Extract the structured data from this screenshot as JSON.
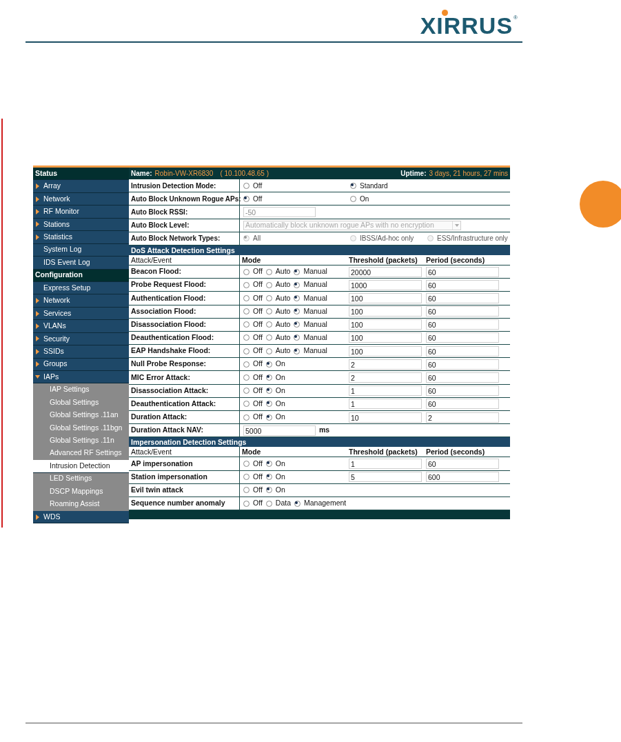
{
  "logo": {
    "text": "XIRRUS",
    "mark": "®"
  },
  "sidebar": [
    {
      "label": "Status",
      "kind": "section"
    },
    {
      "label": "Array",
      "kind": "item",
      "expanded": false,
      "selected": false
    },
    {
      "label": "Network",
      "kind": "item",
      "expanded": false,
      "selected": false
    },
    {
      "label": "RF Monitor",
      "kind": "item",
      "expanded": false,
      "selected": false
    },
    {
      "label": "Stations",
      "kind": "item",
      "expanded": false,
      "selected": false
    },
    {
      "label": "Statistics",
      "kind": "item",
      "expanded": false,
      "selected": false
    },
    {
      "label": "System Log",
      "kind": "item",
      "selected": false
    },
    {
      "label": "IDS Event Log",
      "kind": "item",
      "selected": false
    },
    {
      "label": "Configuration",
      "kind": "section"
    },
    {
      "label": "Express Setup",
      "kind": "item",
      "selected": false
    },
    {
      "label": "Network",
      "kind": "item",
      "expanded": false,
      "selected": false
    },
    {
      "label": "Services",
      "kind": "item",
      "expanded": false,
      "selected": false
    },
    {
      "label": "VLANs",
      "kind": "item",
      "expanded": false,
      "selected": false
    },
    {
      "label": "Security",
      "kind": "item",
      "expanded": false,
      "selected": false
    },
    {
      "label": "SSIDs",
      "kind": "item",
      "expanded": false,
      "selected": false
    },
    {
      "label": "Groups",
      "kind": "item",
      "expanded": false,
      "selected": false
    },
    {
      "label": "IAPs",
      "kind": "item",
      "expanded": true,
      "selected": false
    },
    {
      "label": "IAP Settings",
      "kind": "subitem",
      "selected": false
    },
    {
      "label": "Global Settings",
      "kind": "subitem",
      "selected": false
    },
    {
      "label": "Global Settings .11an",
      "kind": "subitem",
      "selected": false
    },
    {
      "label": "Global Settings .11bgn",
      "kind": "subitem",
      "selected": false
    },
    {
      "label": "Global Settings .11n",
      "kind": "subitem",
      "selected": false
    },
    {
      "label": "Advanced RF Settings",
      "kind": "subitem",
      "selected": false
    },
    {
      "label": "Intrusion Detection",
      "kind": "subitem",
      "selected": true
    },
    {
      "label": "LED Settings",
      "kind": "subitem",
      "selected": false
    },
    {
      "label": "DSCP Mappings",
      "kind": "subitem",
      "selected": false
    },
    {
      "label": "Roaming Assist",
      "kind": "subitem",
      "selected": false
    },
    {
      "label": "WDS",
      "kind": "item",
      "expanded": false,
      "selected": false
    }
  ],
  "header": {
    "name_label": "Name:",
    "name_value": "Robin-VW-XR6830",
    "address": "( 10.100.48.65 )",
    "uptime_label": "Uptime:",
    "uptime_value": "3 days, 21 hours, 27 mins"
  },
  "settings": [
    {
      "label": "Intrusion Detection Mode:",
      "kind": "radio",
      "options": [
        {
          "label": "Off",
          "selected": false
        },
        {
          "label": "Standard",
          "selected": true
        }
      ]
    },
    {
      "label": "Auto Block Unknown Rogue APs:",
      "kind": "radio",
      "options": [
        {
          "label": "Off",
          "selected": true
        },
        {
          "label": "On",
          "selected": false
        }
      ]
    },
    {
      "label": "Auto Block RSSI:",
      "kind": "field",
      "disabled": true,
      "value": "-50"
    },
    {
      "label": "Auto Block Level:",
      "kind": "select",
      "disabled": true,
      "value": "Automatically block unknown rogue APs with no encryption"
    },
    {
      "label": "Auto Block Network Types:",
      "kind": "radio",
      "disabled": true,
      "options": [
        {
          "label": "All",
          "selected": true
        },
        {
          "label": "IBSS/Ad-hoc only",
          "selected": false
        },
        {
          "label": "ESS/Infrastructure only",
          "selected": false
        }
      ]
    }
  ],
  "sections": [
    {
      "title": "DoS Attack Detection Settings",
      "columns": [
        "Attack/Event",
        "Mode",
        "Threshold (packets)",
        "Period (seconds)"
      ],
      "rows": [
        {
          "label": "Beacon Flood:",
          "kind": "attack",
          "options": [
            {
              "label": "Off",
              "selected": false
            },
            {
              "label": "Auto",
              "selected": false
            },
            {
              "label": "Manual",
              "selected": true
            }
          ],
          "threshold": "20000",
          "period": "60"
        },
        {
          "label": "Probe Request Flood:",
          "kind": "attack",
          "options": [
            {
              "label": "Off",
              "selected": false
            },
            {
              "label": "Auto",
              "selected": false
            },
            {
              "label": "Manual",
              "selected": true
            }
          ],
          "threshold": "1000",
          "period": "60"
        },
        {
          "label": "Authentication Flood:",
          "kind": "attack",
          "options": [
            {
              "label": "Off",
              "selected": false
            },
            {
              "label": "Auto",
              "selected": false
            },
            {
              "label": "Manual",
              "selected": true
            }
          ],
          "threshold": "100",
          "period": "60"
        },
        {
          "label": "Association Flood:",
          "kind": "attack",
          "options": [
            {
              "label": "Off",
              "selected": false
            },
            {
              "label": "Auto",
              "selected": false
            },
            {
              "label": "Manual",
              "selected": true
            }
          ],
          "threshold": "100",
          "period": "60"
        },
        {
          "label": "Disassociation Flood:",
          "kind": "attack",
          "options": [
            {
              "label": "Off",
              "selected": false
            },
            {
              "label": "Auto",
              "selected": false
            },
            {
              "label": "Manual",
              "selected": true
            }
          ],
          "threshold": "100",
          "period": "60"
        },
        {
          "label": "Deauthentication Flood:",
          "kind": "attack",
          "options": [
            {
              "label": "Off",
              "selected": false
            },
            {
              "label": "Auto",
              "selected": false
            },
            {
              "label": "Manual",
              "selected": true
            }
          ],
          "threshold": "100",
          "period": "60"
        },
        {
          "label": "EAP Handshake Flood:",
          "kind": "attack",
          "options": [
            {
              "label": "Off",
              "selected": false
            },
            {
              "label": "Auto",
              "selected": false
            },
            {
              "label": "Manual",
              "selected": true
            }
          ],
          "threshold": "100",
          "period": "60"
        },
        {
          "label": "Null Probe Response:",
          "kind": "attack",
          "options": [
            {
              "label": "Off",
              "selected": false
            },
            {
              "label": "On",
              "selected": true
            }
          ],
          "threshold": "2",
          "period": "60"
        },
        {
          "label": "MIC Error Attack:",
          "kind": "attack",
          "options": [
            {
              "label": "Off",
              "selected": false
            },
            {
              "label": "On",
              "selected": true
            }
          ],
          "threshold": "2",
          "period": "60"
        },
        {
          "label": "Disassociation Attack:",
          "kind": "attack",
          "options": [
            {
              "label": "Off",
              "selected": false
            },
            {
              "label": "On",
              "selected": true
            }
          ],
          "threshold": "1",
          "period": "60"
        },
        {
          "label": "Deauthentication Attack:",
          "kind": "attack",
          "options": [
            {
              "label": "Off",
              "selected": false
            },
            {
              "label": "On",
              "selected": true
            }
          ],
          "threshold": "1",
          "period": "60"
        },
        {
          "label": "Duration Attack:",
          "kind": "attack",
          "options": [
            {
              "label": "Off",
              "selected": false
            },
            {
              "label": "On",
              "selected": true
            }
          ],
          "threshold": "10",
          "period": "2"
        },
        {
          "label": "Duration Attack NAV:",
          "kind": "value",
          "value": "5000",
          "unit": "ms"
        }
      ]
    },
    {
      "title": "Impersonation Detection Settings",
      "columns": [
        "Attack/Event",
        "Mode",
        "Threshold (packets)",
        "Period (seconds)"
      ],
      "rows": [
        {
          "label": "AP impersonation",
          "kind": "attack",
          "options": [
            {
              "label": "Off",
              "selected": false
            },
            {
              "label": "On",
              "selected": true
            }
          ],
          "threshold": "1",
          "period": "60"
        },
        {
          "label": "Station impersonation",
          "kind": "attack",
          "options": [
            {
              "label": "Off",
              "selected": false
            },
            {
              "label": "On",
              "selected": true
            }
          ],
          "threshold": "5",
          "period": "600"
        },
        {
          "label": "Evil twin attack",
          "kind": "mode",
          "options": [
            {
              "label": "Off",
              "selected": false
            },
            {
              "label": "On",
              "selected": true
            }
          ]
        },
        {
          "label": "Sequence number anomaly",
          "kind": "mode",
          "options": [
            {
              "label": "Off",
              "selected": false
            },
            {
              "label": "Data",
              "selected": false
            },
            {
              "label": "Management",
              "selected": true
            }
          ]
        }
      ]
    }
  ]
}
